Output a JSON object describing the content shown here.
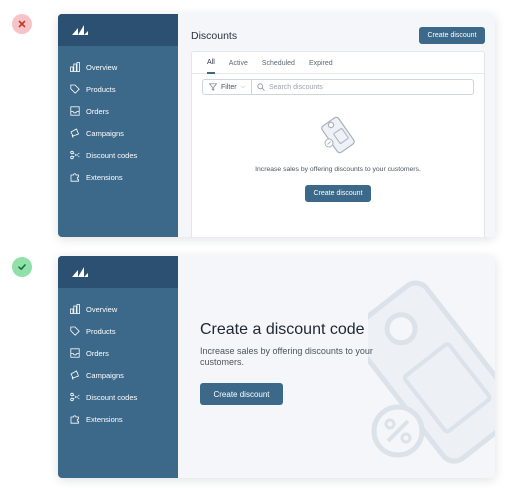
{
  "bad_example": {
    "sidebar": {
      "items": [
        {
          "label": "Overview",
          "icon": "chart-icon"
        },
        {
          "label": "Products",
          "icon": "tag-icon"
        },
        {
          "label": "Orders",
          "icon": "inbox-icon"
        },
        {
          "label": "Campaigns",
          "icon": "megaphone-icon"
        },
        {
          "label": "Discount codes",
          "icon": "scissors-icon"
        },
        {
          "label": "Extensions",
          "icon": "puzzle-icon"
        }
      ]
    },
    "page_title": "Discounts",
    "header_button": "Create discount",
    "tabs": [
      "All",
      "Active",
      "Scheduled",
      "Expired"
    ],
    "filter_label": "Filter",
    "search_placeholder": "Search discounts",
    "empty_text": "Increase sales by offering discounts to your customers.",
    "empty_button": "Create discount"
  },
  "good_example": {
    "sidebar": {
      "items": [
        {
          "label": "Overview",
          "icon": "chart-icon"
        },
        {
          "label": "Products",
          "icon": "tag-icon"
        },
        {
          "label": "Orders",
          "icon": "inbox-icon"
        },
        {
          "label": "Campaigns",
          "icon": "megaphone-icon"
        },
        {
          "label": "Discount codes",
          "icon": "scissors-icon"
        },
        {
          "label": "Extensions",
          "icon": "puzzle-icon"
        }
      ]
    },
    "hero_title": "Create a discount code",
    "hero_body": "Increase sales by offering discounts to your customers.",
    "hero_button": "Create discount"
  },
  "colors": {
    "sidebar": "#3c6889",
    "sidebar_header": "#2c5071",
    "primary_button": "#3c6889",
    "bad_badge": "#f6c3c6",
    "good_badge": "#8fe0a9"
  }
}
